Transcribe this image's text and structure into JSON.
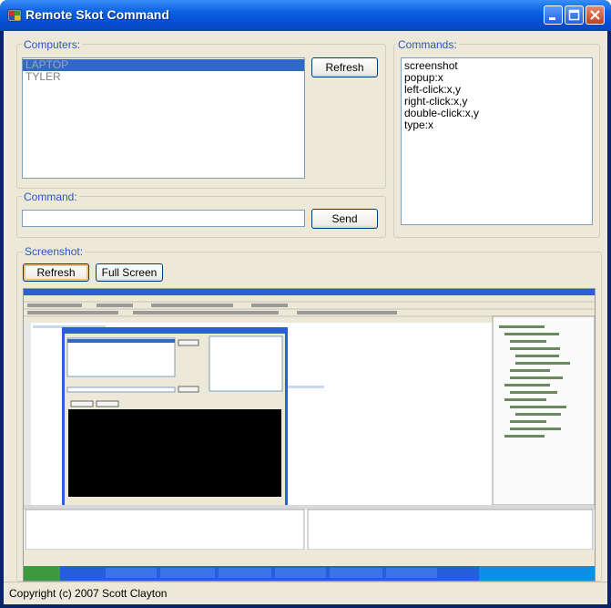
{
  "window": {
    "title": "Remote Skot Command"
  },
  "computers": {
    "label": "Computers:",
    "items": [
      "LAPTOP",
      "TYLER"
    ],
    "selected_index": 0,
    "refresh_label": "Refresh"
  },
  "commands": {
    "label": "Commands:",
    "items": [
      "screenshot",
      "popup:x",
      "left-click:x,y",
      "right-click:x,y",
      "double-click:x,y",
      "type:x"
    ]
  },
  "command": {
    "label": "Command:",
    "value": "",
    "send_label": "Send"
  },
  "screenshot": {
    "label": "Screenshot:",
    "refresh_label": "Refresh",
    "fullscreen_label": "Full Screen"
  },
  "status": {
    "copyright": "Copyright (c) 2007 Scott Clayton"
  },
  "colors": {
    "title_bar": "#0a5fe0",
    "group_label": "#2a55c8",
    "selection": "#316ac5",
    "client_bg": "#ece9d8"
  },
  "icons": [
    "app-icon",
    "minimize-icon",
    "maximize-icon",
    "close-icon"
  ]
}
